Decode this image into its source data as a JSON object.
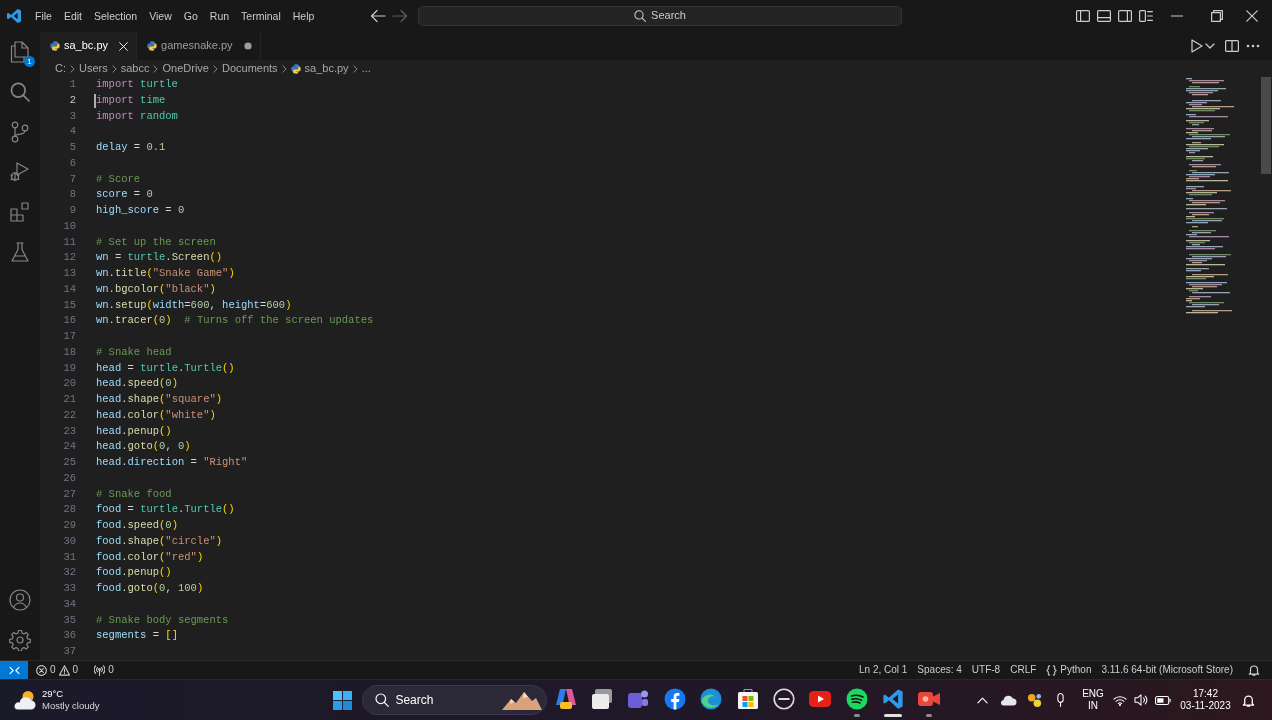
{
  "title_bar": {
    "menu": [
      "File",
      "Edit",
      "Selection",
      "View",
      "Go",
      "Run",
      "Terminal",
      "Help"
    ],
    "search": {
      "label": "Search"
    }
  },
  "activity_bar": {
    "items": [
      {
        "kind": "explorer",
        "badge": "1"
      },
      {
        "kind": "search"
      },
      {
        "kind": "source-control"
      },
      {
        "kind": "run-debug"
      },
      {
        "kind": "extensions"
      },
      {
        "kind": "testing"
      }
    ],
    "bottom_items": [
      {
        "kind": "account"
      },
      {
        "kind": "settings"
      }
    ]
  },
  "tabs": [
    {
      "label": "sa_bc.py",
      "selected": true,
      "modified": false
    },
    {
      "label": "gamesnake.py",
      "selected": false,
      "modified": true
    }
  ],
  "breadcrumbs": [
    {
      "kind": "folder",
      "text": "C:"
    },
    {
      "kind": "folder",
      "text": "Users"
    },
    {
      "kind": "folder",
      "text": "sabcc"
    },
    {
      "kind": "folder",
      "text": "OneDrive"
    },
    {
      "kind": "folder",
      "text": "Documents"
    },
    {
      "kind": "file",
      "text": "sa_bc.py"
    },
    {
      "kind": "symbol",
      "text": "..."
    }
  ],
  "editor": {
    "lines": [
      {
        "number": "1",
        "active": false,
        "tokens": [
          {
            "kind": "keyword",
            "text": "import"
          },
          {
            "kind": "module",
            "text": " turtle"
          }
        ]
      },
      {
        "number": "2",
        "active": true,
        "tokens": [
          {
            "kind": "keyword",
            "text": "import"
          },
          {
            "kind": "module",
            "text": " time"
          }
        ]
      },
      {
        "number": "3",
        "active": false,
        "tokens": [
          {
            "kind": "keyword",
            "text": "import"
          },
          {
            "kind": "module",
            "text": " random"
          }
        ]
      },
      {
        "number": "4",
        "active": false
      },
      {
        "number": "5",
        "active": false,
        "tokens": [
          {
            "kind": "variable",
            "text": "delay"
          },
          {
            "kind": "operator",
            "text": " = "
          },
          {
            "kind": "number",
            "text": "0.1"
          }
        ]
      },
      {
        "number": "6",
        "active": false
      },
      {
        "number": "7",
        "active": false,
        "tokens": [
          {
            "kind": "comment",
            "text": "# Score"
          }
        ]
      },
      {
        "number": "8",
        "active": false,
        "tokens": [
          {
            "kind": "variable",
            "text": "score"
          },
          {
            "kind": "operator",
            "text": " = "
          },
          {
            "kind": "number",
            "text": "0"
          }
        ]
      },
      {
        "number": "9",
        "active": false,
        "tokens": [
          {
            "kind": "variable",
            "text": "high_score"
          },
          {
            "kind": "operator",
            "text": " = "
          },
          {
            "kind": "number",
            "text": "0"
          }
        ]
      },
      {
        "number": "10",
        "active": false
      },
      {
        "number": "11",
        "active": false,
        "tokens": [
          {
            "kind": "comment",
            "text": "# Set up the screen"
          }
        ]
      },
      {
        "number": "12",
        "active": false,
        "tokens": [
          {
            "kind": "variable",
            "text": "wn"
          },
          {
            "kind": "operator",
            "text": " = "
          },
          {
            "kind": "module",
            "text": "turtle"
          },
          {
            "kind": "operator",
            "text": "."
          },
          {
            "kind": "function",
            "text": "Screen"
          },
          {
            "kind": "bracket",
            "text": "()"
          }
        ]
      },
      {
        "number": "13",
        "active": false,
        "tokens": [
          {
            "kind": "variable",
            "text": "wn"
          },
          {
            "kind": "operator",
            "text": "."
          },
          {
            "kind": "function",
            "text": "title"
          },
          {
            "kind": "bracket",
            "text": "("
          },
          {
            "kind": "string",
            "text": "\"Snake Game\""
          },
          {
            "kind": "bracket",
            "text": ")"
          }
        ]
      },
      {
        "number": "14",
        "active": false,
        "tokens": [
          {
            "kind": "variable",
            "text": "wn"
          },
          {
            "kind": "operator",
            "text": "."
          },
          {
            "kind": "function",
            "text": "bgcolor"
          },
          {
            "kind": "bracket",
            "text": "("
          },
          {
            "kind": "string",
            "text": "\"black\""
          },
          {
            "kind": "bracket",
            "text": ")"
          }
        ]
      },
      {
        "number": "15",
        "active": false,
        "tokens": [
          {
            "kind": "variable",
            "text": "wn"
          },
          {
            "kind": "operator",
            "text": "."
          },
          {
            "kind": "function",
            "text": "setup"
          },
          {
            "kind": "bracket",
            "text": "("
          },
          {
            "kind": "variable",
            "text": "width"
          },
          {
            "kind": "operator",
            "text": "="
          },
          {
            "kind": "number",
            "text": "600"
          },
          {
            "kind": "operator",
            "text": ", "
          },
          {
            "kind": "variable",
            "text": "height"
          },
          {
            "kind": "operator",
            "text": "="
          },
          {
            "kind": "number",
            "text": "600"
          },
          {
            "kind": "bracket",
            "text": ")"
          }
        ]
      },
      {
        "number": "16",
        "active": false,
        "tokens": [
          {
            "kind": "variable",
            "text": "wn"
          },
          {
            "kind": "operator",
            "text": "."
          },
          {
            "kind": "function",
            "text": "tracer"
          },
          {
            "kind": "bracket",
            "text": "("
          },
          {
            "kind": "number",
            "text": "0"
          },
          {
            "kind": "bracket",
            "text": ")"
          },
          {
            "kind": "comment",
            "text": "  # Turns off the screen updates"
          }
        ]
      },
      {
        "number": "17",
        "active": false
      },
      {
        "number": "18",
        "active": false,
        "tokens": [
          {
            "kind": "comment",
            "text": "# Snake head"
          }
        ]
      },
      {
        "number": "19",
        "active": false,
        "tokens": [
          {
            "kind": "variable",
            "text": "head"
          },
          {
            "kind": "operator",
            "text": " = "
          },
          {
            "kind": "module",
            "text": "turtle"
          },
          {
            "kind": "operator",
            "text": "."
          },
          {
            "kind": "class",
            "text": "Turtle"
          },
          {
            "kind": "bracket",
            "text": "()"
          }
        ]
      },
      {
        "number": "20",
        "active": false,
        "tokens": [
          {
            "kind": "variable",
            "text": "head"
          },
          {
            "kind": "operator",
            "text": "."
          },
          {
            "kind": "function",
            "text": "speed"
          },
          {
            "kind": "bracket",
            "text": "("
          },
          {
            "kind": "number",
            "text": "0"
          },
          {
            "kind": "bracket",
            "text": ")"
          }
        ]
      },
      {
        "number": "21",
        "active": false,
        "tokens": [
          {
            "kind": "variable",
            "text": "head"
          },
          {
            "kind": "operator",
            "text": "."
          },
          {
            "kind": "function",
            "text": "shape"
          },
          {
            "kind": "bracket",
            "text": "("
          },
          {
            "kind": "string",
            "text": "\"square\""
          },
          {
            "kind": "bracket",
            "text": ")"
          }
        ]
      },
      {
        "number": "22",
        "active": false,
        "tokens": [
          {
            "kind": "variable",
            "text": "head"
          },
          {
            "kind": "operator",
            "text": "."
          },
          {
            "kind": "function",
            "text": "color"
          },
          {
            "kind": "bracket",
            "text": "("
          },
          {
            "kind": "string",
            "text": "\"white\""
          },
          {
            "kind": "bracket",
            "text": ")"
          }
        ]
      },
      {
        "number": "23",
        "active": false,
        "tokens": [
          {
            "kind": "variable",
            "text": "head"
          },
          {
            "kind": "operator",
            "text": "."
          },
          {
            "kind": "function",
            "text": "penup"
          },
          {
            "kind": "bracket",
            "text": "()"
          }
        ]
      },
      {
        "number": "24",
        "active": false,
        "tokens": [
          {
            "kind": "variable",
            "text": "head"
          },
          {
            "kind": "operator",
            "text": "."
          },
          {
            "kind": "function",
            "text": "goto"
          },
          {
            "kind": "bracket",
            "text": "("
          },
          {
            "kind": "number",
            "text": "0"
          },
          {
            "kind": "operator",
            "text": ", "
          },
          {
            "kind": "number",
            "text": "0"
          },
          {
            "kind": "bracket",
            "text": ")"
          }
        ]
      },
      {
        "number": "25",
        "active": false,
        "tokens": [
          {
            "kind": "variable",
            "text": "head"
          },
          {
            "kind": "operator",
            "text": "."
          },
          {
            "kind": "variable",
            "text": "direction"
          },
          {
            "kind": "operator",
            "text": " = "
          },
          {
            "kind": "string",
            "text": "\"Right\""
          }
        ]
      },
      {
        "number": "26",
        "active": false
      },
      {
        "number": "27",
        "active": false,
        "tokens": [
          {
            "kind": "comment",
            "text": "# Snake food"
          }
        ]
      },
      {
        "number": "28",
        "active": false,
        "tokens": [
          {
            "kind": "variable",
            "text": "food"
          },
          {
            "kind": "operator",
            "text": " = "
          },
          {
            "kind": "module",
            "text": "turtle"
          },
          {
            "kind": "operator",
            "text": "."
          },
          {
            "kind": "class",
            "text": "Turtle"
          },
          {
            "kind": "bracket",
            "text": "()"
          }
        ]
      },
      {
        "number": "29",
        "active": false,
        "tokens": [
          {
            "kind": "variable",
            "text": "food"
          },
          {
            "kind": "operator",
            "text": "."
          },
          {
            "kind": "function",
            "text": "speed"
          },
          {
            "kind": "bracket",
            "text": "("
          },
          {
            "kind": "number",
            "text": "0"
          },
          {
            "kind": "bracket",
            "text": ")"
          }
        ]
      },
      {
        "number": "30",
        "active": false,
        "tokens": [
          {
            "kind": "variable",
            "text": "food"
          },
          {
            "kind": "operator",
            "text": "."
          },
          {
            "kind": "function",
            "text": "shape"
          },
          {
            "kind": "bracket",
            "text": "("
          },
          {
            "kind": "string",
            "text": "\"circle\""
          },
          {
            "kind": "bracket",
            "text": ")"
          }
        ]
      },
      {
        "number": "31",
        "active": false,
        "tokens": [
          {
            "kind": "variable",
            "text": "food"
          },
          {
            "kind": "operator",
            "text": "."
          },
          {
            "kind": "function",
            "text": "color"
          },
          {
            "kind": "bracket",
            "text": "("
          },
          {
            "kind": "string",
            "text": "\"red\""
          },
          {
            "kind": "bracket",
            "text": ")"
          }
        ]
      },
      {
        "number": "32",
        "active": false,
        "tokens": [
          {
            "kind": "variable",
            "text": "food"
          },
          {
            "kind": "operator",
            "text": "."
          },
          {
            "kind": "function",
            "text": "penup"
          },
          {
            "kind": "bracket",
            "text": "()"
          }
        ]
      },
      {
        "number": "33",
        "active": false,
        "tokens": [
          {
            "kind": "variable",
            "text": "food"
          },
          {
            "kind": "operator",
            "text": "."
          },
          {
            "kind": "function",
            "text": "goto"
          },
          {
            "kind": "bracket",
            "text": "("
          },
          {
            "kind": "number",
            "text": "0"
          },
          {
            "kind": "operator",
            "text": ", "
          },
          {
            "kind": "number",
            "text": "100"
          },
          {
            "kind": "bracket",
            "text": ")"
          }
        ]
      },
      {
        "number": "34",
        "active": false
      },
      {
        "number": "35",
        "active": false,
        "tokens": [
          {
            "kind": "comment",
            "text": "# Snake body segments"
          }
        ]
      },
      {
        "number": "36",
        "active": false,
        "tokens": [
          {
            "kind": "variable",
            "text": "segments"
          },
          {
            "kind": "operator",
            "text": " = "
          },
          {
            "kind": "bracket",
            "text": "[]"
          }
        ]
      },
      {
        "number": "37",
        "active": false
      }
    ]
  },
  "status_bar": {
    "problems": {
      "errors": "0",
      "warnings": "0"
    },
    "ports": "0",
    "items": [
      {
        "kind": "text",
        "text": "Ln 2, Col 1"
      },
      {
        "kind": "text",
        "text": "Spaces: 4"
      },
      {
        "kind": "text",
        "text": "UTF-8"
      },
      {
        "kind": "text",
        "text": "CRLF"
      },
      {
        "kind": "language",
        "text": "Python"
      },
      {
        "kind": "text",
        "text": "3.11.6 64-bit (Microsoft Store)"
      }
    ]
  },
  "taskbar": {
    "weather": {
      "temperature": "29°C",
      "condition": "Mostly cloudy"
    },
    "search": {
      "label": "Search"
    },
    "apps": [
      {
        "kind": "arch",
        "running": false,
        "active": false
      },
      {
        "kind": "stacked",
        "running": false,
        "active": false
      },
      {
        "kind": "chat",
        "running": false,
        "active": false
      },
      {
        "kind": "f-circle",
        "running": false,
        "active": false
      },
      {
        "kind": "swirl",
        "running": false,
        "active": false
      },
      {
        "kind": "bag",
        "running": false,
        "active": false
      },
      {
        "kind": "ring",
        "running": false,
        "active": false
      },
      {
        "kind": "play",
        "running": false,
        "active": false
      },
      {
        "kind": "arcs-circle",
        "running": true,
        "active": false
      },
      {
        "kind": "ribbon",
        "running": true,
        "active": true
      },
      {
        "kind": "camera",
        "running": true,
        "active": false
      }
    ],
    "tray": {
      "language": "ENG",
      "region": "IN",
      "time": "17:42",
      "date": "03-11-2023"
    }
  }
}
